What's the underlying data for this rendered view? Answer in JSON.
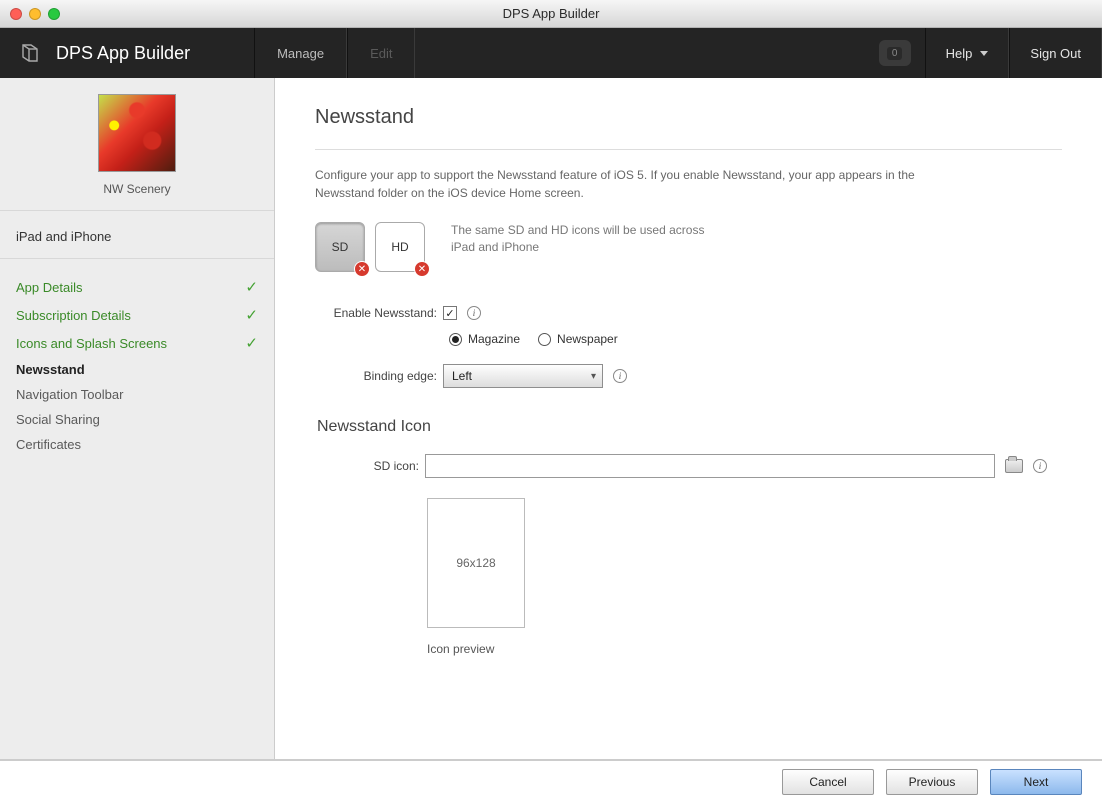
{
  "window": {
    "title": "DPS App Builder"
  },
  "topbar": {
    "app_title": "DPS App Builder",
    "menu": {
      "manage": "Manage",
      "edit": "Edit"
    },
    "notification_count": "0",
    "help": "Help",
    "sign_out": "Sign Out"
  },
  "sidebar": {
    "app_name": "NW Scenery",
    "device_scope": "iPad and iPhone",
    "items": [
      {
        "label": "App Details",
        "state": "done"
      },
      {
        "label": "Subscription Details",
        "state": "done"
      },
      {
        "label": "Icons and Splash Screens",
        "state": "done"
      },
      {
        "label": "Newsstand",
        "state": "active"
      },
      {
        "label": "Navigation Toolbar",
        "state": ""
      },
      {
        "label": "Social Sharing",
        "state": ""
      },
      {
        "label": "Certificates",
        "state": ""
      }
    ]
  },
  "page": {
    "title": "Newsstand",
    "intro": "Configure your app to support the Newsstand feature of iOS 5. If you enable Newsstand, your app appears in the Newsstand folder on the iOS device Home screen.",
    "sd_label": "SD",
    "hd_label": "HD",
    "icon_note": "The same SD and HD icons will be used across iPad and iPhone",
    "enable_label": "Enable Newsstand:",
    "radio_magazine": "Magazine",
    "radio_newspaper": "Newspaper",
    "binding_label": "Binding edge:",
    "binding_value": "Left",
    "section_icon": "Newsstand Icon",
    "sd_icon_label": "SD icon:",
    "sd_icon_value": "",
    "preview_dims": "96x128",
    "preview_label": "Icon preview"
  },
  "footer": {
    "cancel": "Cancel",
    "previous": "Previous",
    "next": "Next"
  }
}
